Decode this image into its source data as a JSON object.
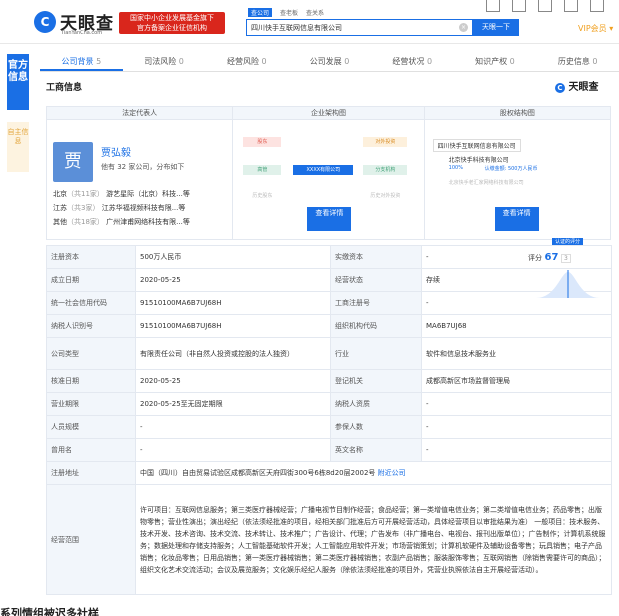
{
  "header": {
    "logo_char": "C",
    "logo_text": "天眼查",
    "logo_url": "TianYanCha.com",
    "gov_badge_line1": "国家中小企业发展基金旗下",
    "gov_badge_line2": "官方备案企业征信机构",
    "search_tabs": [
      "查公司",
      "查老板",
      "查关系"
    ],
    "search_value": "四川快手互联网信息有限公司",
    "search_button": "天眼一下",
    "vip_label": "VIP会员"
  },
  "side_tabs": {
    "official": "官方信息",
    "self": "自主信息"
  },
  "nav": [
    {
      "label": "公司背景",
      "count": "5"
    },
    {
      "label": "司法风险",
      "count": "0"
    },
    {
      "label": "经营风险",
      "count": "0"
    },
    {
      "label": "公司发展",
      "count": "0"
    },
    {
      "label": "经营状况",
      "count": "0"
    },
    {
      "label": "知识产权",
      "count": "0"
    },
    {
      "label": "历史信息",
      "count": "0"
    }
  ],
  "section_title": "工商信息",
  "brand_right": "天眼查",
  "panels": {
    "legal_rep_head": "法定代表人",
    "structure_head": "企业架构图",
    "equity_head": "股权结构图",
    "avatar_char": "贾",
    "legal_rep_name": "贾弘毅",
    "legal_rep_sub": "他有 32 家公司，分布如下",
    "legal_rep_rows": [
      {
        "region": "北京",
        "count": "（共11家）",
        "company": "游艺星际（北京）科技...等"
      },
      {
        "region": "江苏",
        "count": "（共3家）",
        "company": "江苏华福视频科技有限...等"
      },
      {
        "region": "其他",
        "count": "（共18家）",
        "company": "广州津甫网络科技有限...等"
      }
    ],
    "structure_nodes": {
      "shareholder": "股东",
      "executive": "高管",
      "history": "历史股东",
      "center": "XXXX有限公司",
      "invest": "对外投资",
      "branch": "分支机构",
      "history_invest": "历史对外投资"
    },
    "equity_root": "四川快手互联网信息有限公司",
    "equity_holder": "北京快手科技有限公司",
    "equity_ratio": "100%",
    "equity_capital": "认缴金额: 500万人民币",
    "equity_parent": "北京快手老汇家网络科技有限公司",
    "view_label": "查看详情"
  },
  "rating": {
    "label": "评分",
    "score": "67",
    "sub": "3",
    "badge": "认证的评分"
  },
  "table": [
    [
      "注册资本",
      "500万人民币",
      "实缴资本",
      "-"
    ],
    [
      "成立日期",
      "2020-05-25",
      "经营状态",
      "存续"
    ],
    [
      "统一社会信用代码",
      "91510100MA6B7UJ68H",
      "工商注册号",
      "-"
    ],
    [
      "纳税人识别号",
      "91510100MA6B7UJ68H",
      "组织机构代码",
      "MA6B7UJ68"
    ],
    [
      "公司类型",
      "有限责任公司（非自然人投资或控股的法人独资）",
      "行业",
      "软件和信息技术服务业"
    ],
    [
      "核准日期",
      "2020-05-25",
      "登记机关",
      "成都高新区市场监督管理局"
    ],
    [
      "营业期限",
      "2020-05-25至无固定期限",
      "纳税人资质",
      "-"
    ],
    [
      "人员规模",
      "-",
      "参保人数",
      "-"
    ],
    [
      "曾用名",
      "-",
      "英文名称",
      "-"
    ]
  ],
  "address_label": "注册地址",
  "address_value": "中国（四川）自由贸易试验区成都高新区天府四街300号6栋8d20层2002号",
  "address_link": "附近公司",
  "scope_label": "经营范围",
  "scope_value": "许可项目：互联网信息服务；第三类医疗器械经营；广播电视节目制作经营；食品经营；第一类增值电信业务；第二类增值电信业务；药品零售；出版物零售；营业性演出；演出经纪（依法须经批准的项目，经相关部门批准后方可开展经营活动，具体经营项目以审批结果为准） 一般项目：技术服务、技术开发、技术咨询、技术交流、技术转让、技术推广；广告设计、代理；广告发布（非广播电台、电视台、报刊出版单位）；广告制作；计算机系统服务；数据处理和存储支持服务；人工智能基础软件开发；人工智能应用软件开发；市场营销策划；计算机软硬件及辅助设备零售；玩具销售；电子产品销售；化妆品零售；日用品销售；第一类医疗器械销售；第二类医疗器械销售；农副产品销售；服装服饰零售；互联网销售（除销售需要许可的商品）；组织文化艺术交流活动；会议及展览服务；文化娱乐经纪人服务（除依法须经批准的项目外，凭营业执照依法自主开展经营活动）。",
  "bottom_text": "系列情组被迟多社样"
}
